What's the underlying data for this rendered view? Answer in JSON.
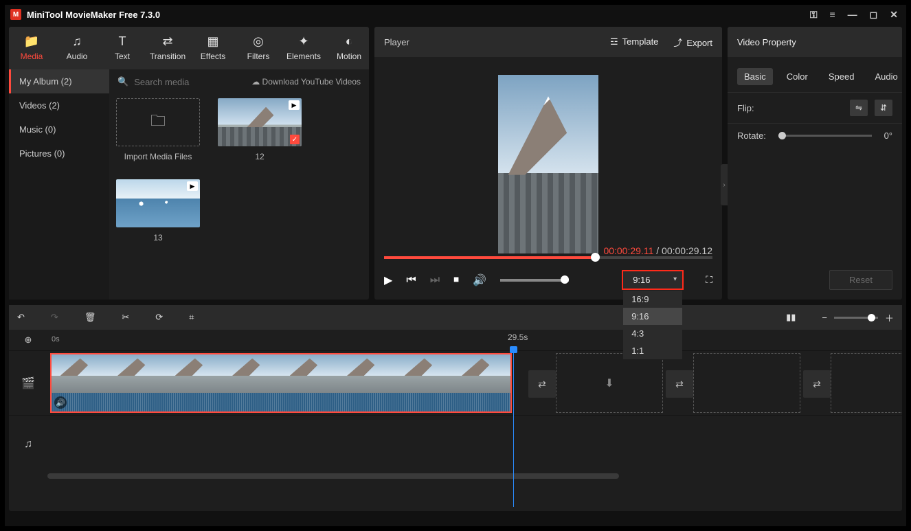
{
  "app_title": "MiniTool MovieMaker Free 7.3.0",
  "top_tabs": [
    {
      "label": "Media",
      "icon": "📁",
      "active": true
    },
    {
      "label": "Audio",
      "icon": "♫"
    },
    {
      "label": "Text",
      "icon": "T"
    },
    {
      "label": "Transition",
      "icon": "⇄"
    },
    {
      "label": "Effects",
      "icon": "▦"
    },
    {
      "label": "Filters",
      "icon": "◎"
    },
    {
      "label": "Elements",
      "icon": "✦"
    },
    {
      "label": "Motion",
      "icon": "◐"
    }
  ],
  "side_items": [
    {
      "label": "My Album (2)",
      "active": true
    },
    {
      "label": "Videos (2)"
    },
    {
      "label": "Music (0)"
    },
    {
      "label": "Pictures (0)"
    }
  ],
  "search_placeholder": "Search media",
  "download_label": "Download YouTube Videos",
  "media_items": [
    {
      "label": "Import Media Files",
      "type": "import"
    },
    {
      "label": "12",
      "type": "video",
      "selected": true,
      "scene": "mountain"
    },
    {
      "label": "13",
      "type": "video",
      "scene": "lake"
    }
  ],
  "player": {
    "title": "Player",
    "template_label": "Template",
    "export_label": "Export",
    "current_time": "00:00:29.11",
    "total_time": "00:00:29.12"
  },
  "aspect": {
    "selected": "9:16",
    "options": [
      "16:9",
      "9:16",
      "4:3",
      "1:1"
    ]
  },
  "property": {
    "title": "Video Property",
    "tabs": [
      "Basic",
      "Color",
      "Speed",
      "Audio"
    ],
    "active_tab": "Basic",
    "flip_label": "Flip:",
    "rotate_label": "Rotate:",
    "rotate_value": "0°",
    "reset_label": "Reset"
  },
  "timeline": {
    "start_label": "0s",
    "marker_label": "29.5s"
  }
}
